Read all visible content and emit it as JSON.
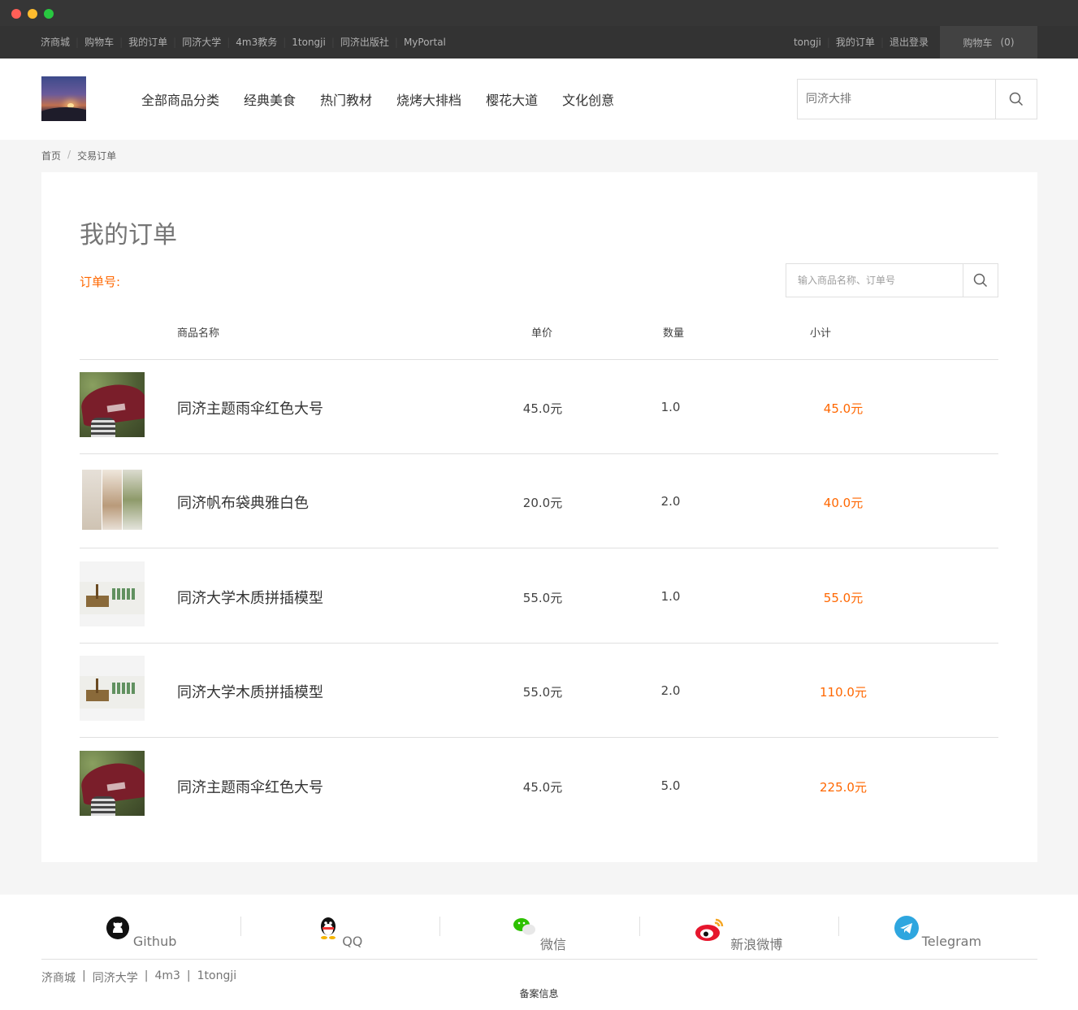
{
  "topnav": {
    "left_links": [
      "济商城",
      "购物车",
      "我的订单",
      "同济大学",
      "4m3教务",
      "1tongji",
      "同济出版社",
      "MyPortal"
    ],
    "right_links": [
      "tongji",
      "我的订单",
      "退出登录"
    ],
    "cart_label": "购物车",
    "cart_count": "(0)"
  },
  "header": {
    "categories": [
      "全部商品分类",
      "经典美食",
      "热门教材",
      "烧烤大排档",
      "樱花大道",
      "文化创意"
    ],
    "search_placeholder": "同济大排"
  },
  "breadcrumb": {
    "home": "首页",
    "separator": "/",
    "current": "交易订单"
  },
  "orders": {
    "title": "我的订单",
    "order_no_label": "订单号:",
    "search_placeholder": "输入商品名称、订单号",
    "columns": {
      "name": "商品名称",
      "price": "单价",
      "qty": "数量",
      "subtotal": "小计"
    },
    "rows": [
      {
        "image": "umbrella-image",
        "name": "同济主题雨伞红色大号",
        "price": "45.0元",
        "qty": "1.0",
        "subtotal": "45.0元"
      },
      {
        "image": "canvas-bag-image",
        "name": "同济帆布袋典雅白色",
        "price": "20.0元",
        "qty": "2.0",
        "subtotal": "40.0元"
      },
      {
        "image": "wood-model-image",
        "name": "同济大学木质拼插模型",
        "price": "55.0元",
        "qty": "1.0",
        "subtotal": "55.0元"
      },
      {
        "image": "wood-model-image",
        "name": "同济大学木质拼插模型",
        "price": "55.0元",
        "qty": "2.0",
        "subtotal": "110.0元"
      },
      {
        "image": "umbrella-image",
        "name": "同济主题雨伞红色大号",
        "price": "45.0元",
        "qty": "5.0",
        "subtotal": "225.0元"
      }
    ]
  },
  "footer": {
    "social": [
      {
        "icon": "github-icon",
        "label": "Github"
      },
      {
        "icon": "qq-icon",
        "label": "QQ"
      },
      {
        "icon": "wechat-icon",
        "label": "微信"
      },
      {
        "icon": "weibo-icon",
        "label": "新浪微博"
      },
      {
        "icon": "telegram-icon",
        "label": "Telegram"
      }
    ],
    "links": [
      "济商城",
      "同济大学",
      "4m3",
      "1tongji"
    ],
    "link_separator": "|",
    "beian": "备案信息"
  },
  "colors": {
    "accent": "#ff6700",
    "topbar": "#333333",
    "cart_bg": "#424242"
  }
}
